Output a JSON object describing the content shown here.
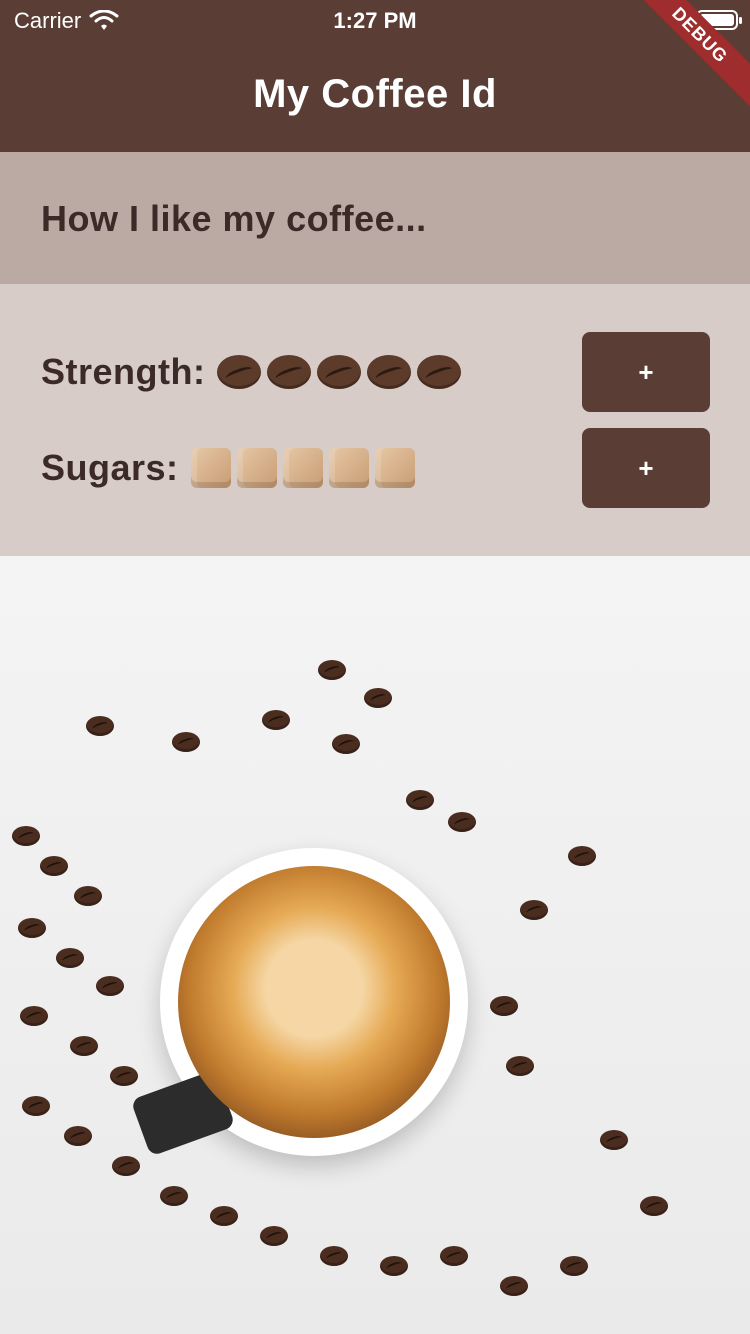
{
  "status_bar": {
    "carrier": "Carrier",
    "time": "1:27 PM"
  },
  "app_bar": {
    "title": "My Coffee Id",
    "debug_banner": "DEBUG"
  },
  "intro": {
    "label": "How I like my coffee..."
  },
  "preferences": {
    "strength": {
      "label": "Strength:",
      "count": 5,
      "icon": "coffee-bean-icon",
      "button_label": "+"
    },
    "sugars": {
      "label": "Sugars:",
      "count": 5,
      "icon": "sugar-cube-icon",
      "button_label": "+"
    }
  },
  "colors": {
    "app_bar": "#5a3e36",
    "intro_band": "#bbaaa3",
    "prefs_band": "#d7ccc8",
    "text_dark": "#3b2a27",
    "button": "#5a3e36"
  }
}
